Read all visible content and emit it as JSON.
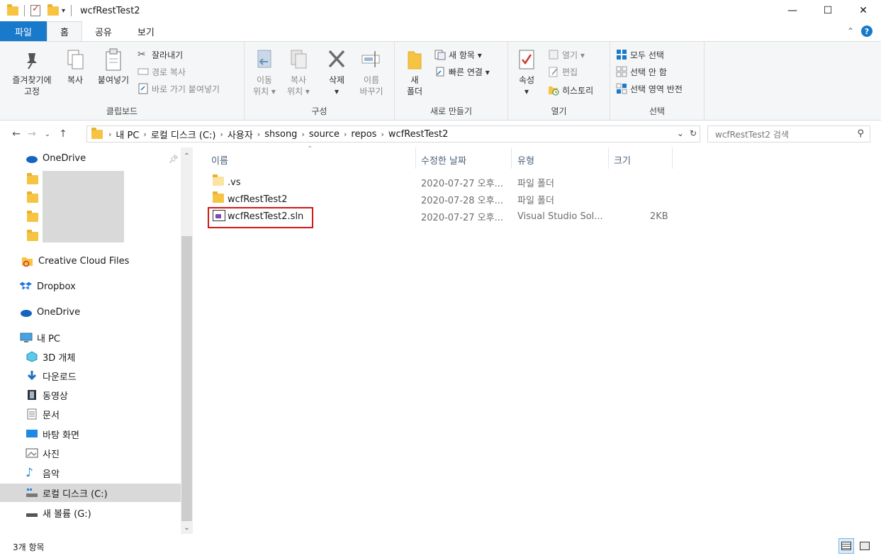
{
  "window": {
    "title": "wcfRestTest2",
    "controls": {
      "minimize": "—",
      "maximize": "☐",
      "close": "✕"
    }
  },
  "ribbon_tabs": [
    "파일",
    "홈",
    "공유",
    "보기"
  ],
  "ribbon": {
    "clipboard": {
      "label": "클립보드",
      "pin": [
        "즐겨찾기에",
        "고정"
      ],
      "copy": "복사",
      "paste": "붙여넣기",
      "cut": "잘라내기",
      "copy_path": "경로 복사",
      "paste_shortcut": "바로 가기 붙여넣기"
    },
    "organize": {
      "label": "구성",
      "move": [
        "이동",
        "위치 ▾"
      ],
      "copyto": [
        "복사",
        "위치 ▾"
      ],
      "delete": [
        "삭제",
        "▾"
      ],
      "rename": [
        "이름",
        "바꾸기"
      ]
    },
    "new": {
      "label": "새로 만들기",
      "new_folder": [
        "새",
        "폴더"
      ],
      "new_item": "새 항목 ▾",
      "easy_access": "빠른 연결 ▾"
    },
    "open": {
      "label": "열기",
      "properties": [
        "속성",
        "▾"
      ],
      "open": "열기 ▾",
      "edit": "편집",
      "history": "히스토리"
    },
    "select": {
      "label": "선택",
      "all": "모두 선택",
      "none": "선택 안 함",
      "invert": "선택 영역 반전"
    }
  },
  "address": {
    "crumbs": [
      "내 PC",
      "로컬 디스크 (C:)",
      "사용자",
      "shsong",
      "source",
      "repos",
      "wcfRestTest2"
    ],
    "search_placeholder": "wcfRestTest2 검색"
  },
  "nav": {
    "items": [
      {
        "label": "OneDrive"
      },
      {
        "label": "Creative Cloud Files"
      },
      {
        "label": "Dropbox"
      },
      {
        "label": "OneDrive"
      },
      {
        "label": "내 PC"
      },
      {
        "label": "3D 개체"
      },
      {
        "label": "다운로드"
      },
      {
        "label": "동영상"
      },
      {
        "label": "문서"
      },
      {
        "label": "바탕 화면"
      },
      {
        "label": "사진"
      },
      {
        "label": "음악"
      },
      {
        "label": "로컬 디스크 (C:)"
      },
      {
        "label": "새 볼륨 (G:)"
      }
    ]
  },
  "files": {
    "columns": [
      "이름",
      "수정한 날짜",
      "유형",
      "크기"
    ],
    "rows": [
      {
        "name": ".vs",
        "date": "2020-07-27 오후...",
        "type": "파일 폴더",
        "size": ""
      },
      {
        "name": "wcfRestTest2",
        "date": "2020-07-28 오후...",
        "type": "파일 폴더",
        "size": ""
      },
      {
        "name": "wcfRestTest2.sln",
        "date": "2020-07-27 오후...",
        "type": "Visual Studio Sol...",
        "size": "2KB"
      }
    ]
  },
  "status": {
    "count": "3개 항목"
  }
}
